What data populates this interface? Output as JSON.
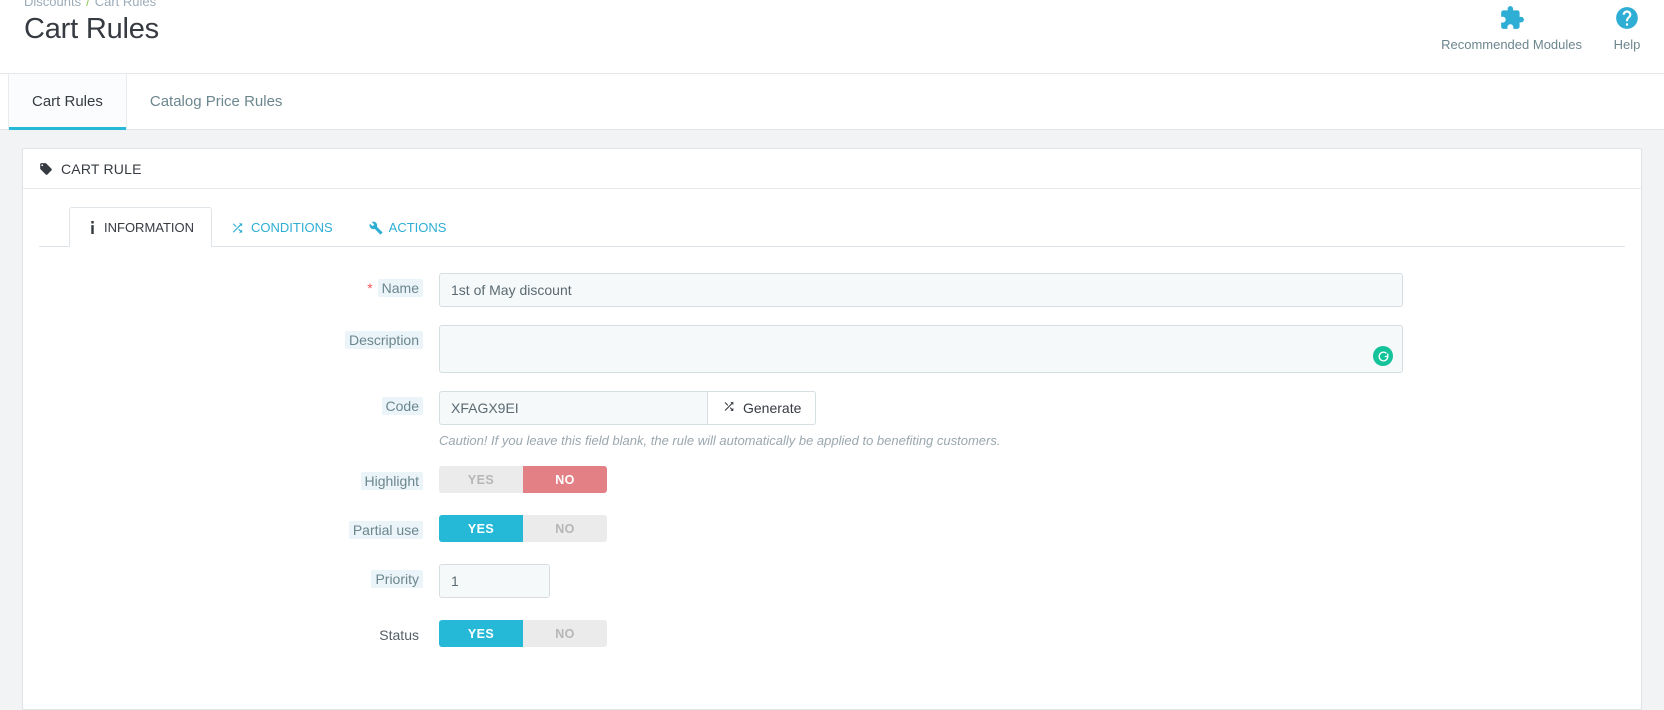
{
  "header": {
    "breadcrumb": {
      "parent": "Discounts",
      "separator": "/",
      "current": "Cart Rules"
    },
    "title": "Cart Rules",
    "actions": [
      {
        "label": "Recommended Modules",
        "icon": "puzzle-piece-icon"
      },
      {
        "label": "Help",
        "icon": "question-circle-icon"
      }
    ]
  },
  "main_tabs": [
    {
      "label": "Cart Rules",
      "active": true
    },
    {
      "label": "Catalog Price Rules",
      "active": false
    }
  ],
  "panel": {
    "heading": "CART RULE",
    "heading_icon": "tag-icon",
    "inner_tabs": [
      {
        "label": "INFORMATION",
        "icon": "info-icon",
        "active": true
      },
      {
        "label": "CONDITIONS",
        "icon": "shuffle-icon",
        "active": false
      },
      {
        "label": "ACTIONS",
        "icon": "wrench-icon",
        "active": false
      }
    ],
    "form": {
      "name": {
        "label": "Name",
        "required": true,
        "required_marker": "*",
        "value": "1st of May discount",
        "placeholder": ""
      },
      "description": {
        "label": "Description",
        "value": "",
        "placeholder": "",
        "badge_icon": "grammarly-icon"
      },
      "code": {
        "label": "Code",
        "value": "XFAGX9EI",
        "placeholder": "",
        "generate_label": "Generate",
        "generate_icon": "shuffle-icon",
        "help_text": "Caution! If you leave this field blank, the rule will automatically be applied to benefiting customers."
      },
      "highlight": {
        "label": "Highlight",
        "yes_label": "YES",
        "no_label": "NO",
        "value": "NO"
      },
      "partial_use": {
        "label": "Partial use",
        "yes_label": "YES",
        "no_label": "NO",
        "value": "YES"
      },
      "priority": {
        "label": "Priority",
        "value": "1",
        "placeholder": ""
      },
      "status": {
        "label": "Status",
        "yes_label": "YES",
        "no_label": "NO",
        "value": "YES"
      }
    }
  },
  "colors": {
    "accent": "#25b9d7",
    "danger": "#e28085",
    "breadcrumb_sep": "#8fcb5a",
    "grammarly_green": "#15c39a",
    "required": "#f0565a"
  }
}
